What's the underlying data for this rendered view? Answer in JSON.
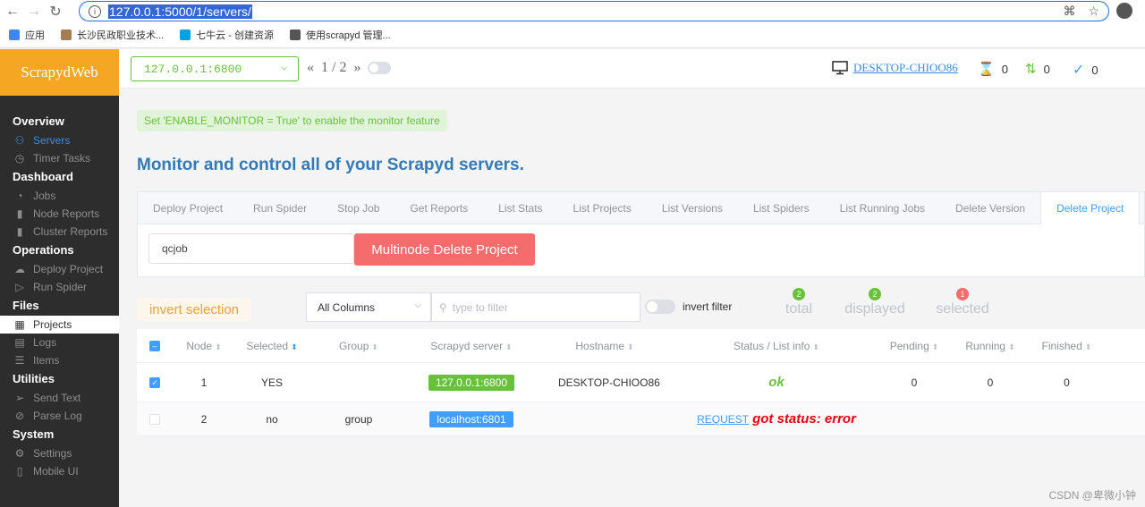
{
  "browser": {
    "url": "127.0.0.1:5000/1/servers/",
    "bookmarks": [
      {
        "label": "应用",
        "color": "#4285f4"
      },
      {
        "label": "长沙民政职业技术...",
        "color": "#a67c52"
      },
      {
        "label": "七牛云 - 创建资源",
        "color": "#00a3e0"
      },
      {
        "label": "使用scrapyd 管理...",
        "color": "#555555"
      }
    ]
  },
  "sidebar": {
    "logo": "ScrapydWeb",
    "sections": [
      {
        "title": "Overview",
        "items": [
          {
            "label": "Servers",
            "icon": "sitemap-icon",
            "glyph": "⚇",
            "state": "blue"
          },
          {
            "label": "Timer Tasks",
            "icon": "timer-icon",
            "glyph": "◷",
            "state": ""
          }
        ]
      },
      {
        "title": "Dashboard",
        "items": [
          {
            "label": "Jobs",
            "icon": "gauge-icon",
            "glyph": "◔",
            "state": ""
          },
          {
            "label": "Node Reports",
            "icon": "bars-icon",
            "glyph": "▮",
            "state": ""
          },
          {
            "label": "Cluster Reports",
            "icon": "cluster-bars-icon",
            "glyph": "▮",
            "state": ""
          }
        ]
      },
      {
        "title": "Operations",
        "items": [
          {
            "label": "Deploy Project",
            "icon": "cloud-upload-icon",
            "glyph": "☁",
            "state": ""
          },
          {
            "label": "Run Spider",
            "icon": "play-icon",
            "glyph": "▷",
            "state": ""
          }
        ]
      },
      {
        "title": "Files",
        "items": [
          {
            "label": "Projects",
            "icon": "grid-icon",
            "glyph": "▦",
            "state": "white"
          },
          {
            "label": "Logs",
            "icon": "document-icon",
            "glyph": "▤",
            "state": ""
          },
          {
            "label": "Items",
            "icon": "list-icon",
            "glyph": "☰",
            "state": ""
          }
        ]
      },
      {
        "title": "Utilities",
        "items": [
          {
            "label": "Send Text",
            "icon": "send-icon",
            "glyph": "➢",
            "state": ""
          },
          {
            "label": "Parse Log",
            "icon": "parse-icon",
            "glyph": "⊘",
            "state": ""
          }
        ]
      },
      {
        "title": "System",
        "items": [
          {
            "label": "Settings",
            "icon": "gear-icon",
            "glyph": "⚙",
            "state": ""
          },
          {
            "label": "Mobile UI",
            "icon": "mobile-icon",
            "glyph": "▯",
            "state": ""
          }
        ]
      }
    ]
  },
  "topbar": {
    "server": "127.0.0.1:6800",
    "pager": "1 / 2",
    "hostname": "DESKTOP-CHIOO86",
    "stats": {
      "pending": "0",
      "running": "0",
      "finished": "0"
    }
  },
  "main": {
    "notice": "Set 'ENABLE_MONITOR = True' to enable the monitor feature",
    "heading": "Monitor and control all of your Scrapyd servers.",
    "tabs": [
      "Deploy Project",
      "Run Spider",
      "Stop Job",
      "Get Reports",
      "List Stats",
      "List Projects",
      "List Versions",
      "List Spiders",
      "List Running Jobs",
      "Delete Version",
      "Delete Project"
    ],
    "active_tab": "Delete Project",
    "project_value": "qcjob",
    "delete_button": "Multinode Delete Project"
  },
  "filters": {
    "invert_selection": "invert selection",
    "column_select": "All Columns",
    "filter_placeholder": "type to filter",
    "invert_filter": "invert filter",
    "counters": [
      {
        "label": "total",
        "count": "2",
        "color": "#67c23a"
      },
      {
        "label": "displayed",
        "count": "2",
        "color": "#67c23a"
      },
      {
        "label": "selected",
        "count": "1",
        "color": "#f56c6c"
      }
    ]
  },
  "table": {
    "columns": [
      "Node",
      "Selected",
      "Group",
      "Scrapyd server",
      "Hostname",
      "Status / List info",
      "Pending",
      "Running",
      "Finished"
    ],
    "rows": [
      {
        "checked": true,
        "node": "1",
        "selected": "YES",
        "group": "",
        "server": "127.0.0.1:6800",
        "server_color": "#67c23a",
        "hostname": "DESKTOP-CHIOO86",
        "status": "ok",
        "request": "",
        "pending": "0",
        "running": "0",
        "finished": "0"
      },
      {
        "checked": false,
        "node": "2",
        "selected": "no",
        "group": "group",
        "server": "localhost:6801",
        "server_color": "#409eff",
        "hostname": "",
        "status": "got status: error",
        "request": "REQUEST",
        "pending": "",
        "running": "",
        "finished": ""
      }
    ]
  },
  "watermark": "CSDN @卑微小钟"
}
